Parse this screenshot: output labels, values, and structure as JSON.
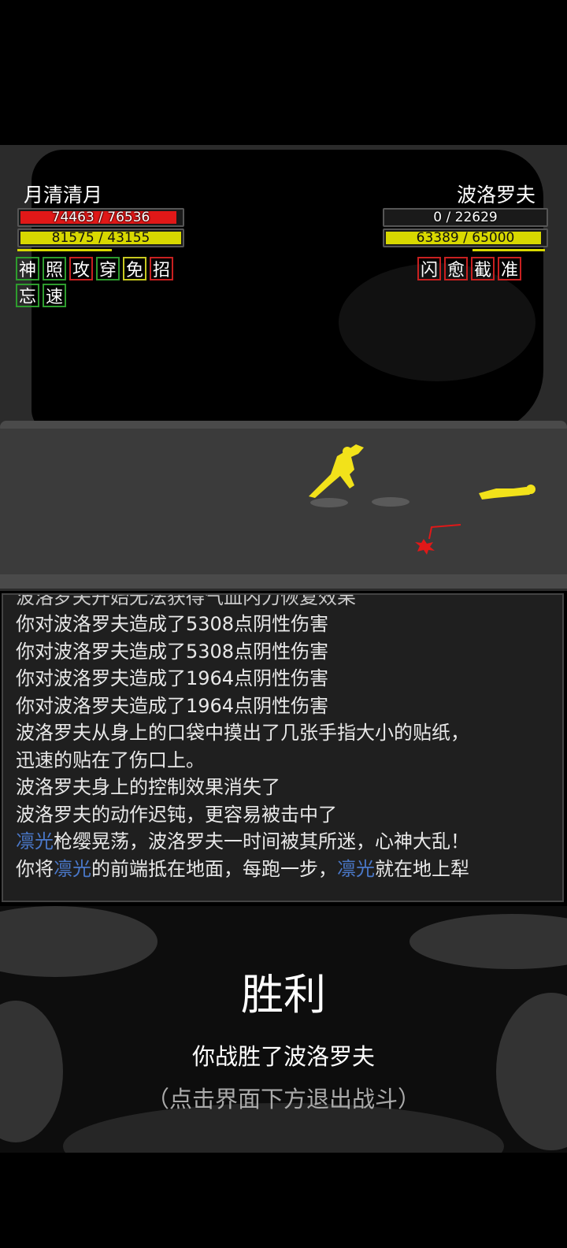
{
  "player": {
    "name": "月清清月",
    "hp": {
      "current": 74463,
      "max": 76536,
      "label": "74463 / 76536"
    },
    "mp": {
      "current": 81575,
      "max": 43155,
      "label": "81575 / 43155"
    },
    "buffs": [
      {
        "char": "神",
        "color": "#2e9c2e"
      },
      {
        "char": "照",
        "color": "#2e9c2e"
      },
      {
        "char": "攻",
        "color": "#c82020"
      },
      {
        "char": "穿",
        "color": "#2e9c2e"
      },
      {
        "char": "免",
        "color": "#c8c820"
      },
      {
        "char": "招",
        "color": "#c82020"
      },
      {
        "char": "忘",
        "color": "#2e9c2e"
      },
      {
        "char": "速",
        "color": "#2e9c2e"
      }
    ]
  },
  "enemy": {
    "name": "波洛罗夫",
    "hp": {
      "current": 0,
      "max": 22629,
      "label": "0 / 22629"
    },
    "mp": {
      "current": 63389,
      "max": 65000,
      "label": "63389 / 65000"
    },
    "debuffs": [
      {
        "char": "闪",
        "color": "#c82020"
      },
      {
        "char": "愈",
        "color": "#c82020"
      },
      {
        "char": "截",
        "color": "#c82020"
      },
      {
        "char": "准",
        "color": "#c82020"
      }
    ]
  },
  "log": {
    "partial_top": "波洛罗夫开始无法获得气血内力恢复效果",
    "lines": [
      [
        {
          "t": "你对波洛罗夫造成了5308点阴性伤害"
        }
      ],
      [
        {
          "t": "你对波洛罗夫造成了5308点阴性伤害"
        }
      ],
      [
        {
          "t": "你对波洛罗夫造成了1964点阴性伤害"
        }
      ],
      [
        {
          "t": "你对波洛罗夫造成了1964点阴性伤害"
        }
      ],
      [
        {
          "t": "波洛罗夫从身上的口袋中摸出了几张手指大小的贴纸，"
        }
      ],
      [
        {
          "t": "迅速的贴在了伤口上。"
        }
      ],
      [
        {
          "t": "波洛罗夫身上的控制效果消失了"
        }
      ],
      [
        {
          "t": "波洛罗夫的动作迟钝，更容易被击中了"
        }
      ],
      [
        {
          "t": "凛光",
          "hl": true
        },
        {
          "t": "枪缨晃荡，波洛罗夫一时间被其所迷，心神大乱！"
        }
      ],
      [
        {
          "t": "你将"
        },
        {
          "t": "凛光",
          "hl": true
        },
        {
          "t": "的前端抵在地面，每跑一步，"
        },
        {
          "t": "凛光",
          "hl": true
        },
        {
          "t": "就在地上犁"
        }
      ]
    ]
  },
  "result": {
    "title": "胜利",
    "subtitle": "你战胜了波洛罗夫",
    "hint": "（点击界面下方退出战斗）"
  },
  "colors": {
    "hp_bar": "#e01818",
    "mp_bar": "#d8d800",
    "highlight": "#4a78c9",
    "figure": "#f2e21a"
  }
}
